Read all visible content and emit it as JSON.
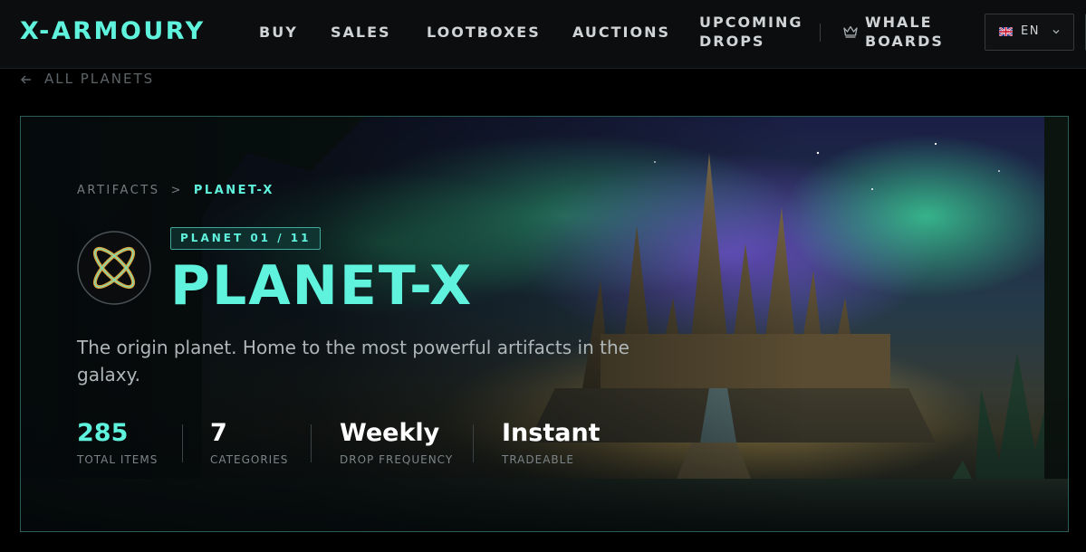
{
  "navbar": {
    "logo": "X-ARMOURY",
    "items": [
      {
        "label": "BUY"
      },
      {
        "label": "SALES"
      },
      {
        "label": "LOOTBOXES"
      },
      {
        "label": "AUCTIONS"
      },
      {
        "label": "UPCOMING DROPS"
      },
      {
        "label": "WHALE BOARDS",
        "icon": "crown-icon"
      }
    ],
    "language": {
      "label": "EN",
      "flag": "uk-flag-icon"
    }
  },
  "back_link": {
    "label": "ALL PLANETS",
    "icon": "arrow-left-icon"
  },
  "hero": {
    "breadcrumb": {
      "parent": "ARTIFACTS",
      "separator": ">",
      "current": "PLANET-X"
    },
    "badge": "PLANET 01 / 11",
    "title": "PLANET-X",
    "description": "The origin planet. Home to the most powerful artifacts in the galaxy.",
    "stats": [
      {
        "value": "285",
        "label": "TOTAL ITEMS"
      },
      {
        "value": "7",
        "label": "CATEGORIES"
      },
      {
        "value": "Weekly",
        "label": "DROP FREQUENCY"
      },
      {
        "value": "Instant",
        "label": "TRADEABLE"
      }
    ]
  },
  "colors": {
    "accent": "#5ff3dd",
    "background": "#000000",
    "nav_bg": "#0c0d0e"
  }
}
